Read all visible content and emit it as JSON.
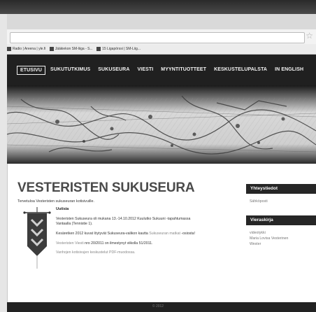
{
  "browser": {
    "bookmarks": [
      {
        "label": "Radio | Areena | yle.fi"
      },
      {
        "label": "Jääkiekon SM-liiga - S..."
      },
      {
        "label": "15 Ligapörssi | SM-Liig..."
      }
    ],
    "star_icon": "star-icon"
  },
  "nav": {
    "items": [
      "ETUSIVU",
      "SUKUTUTKIMUS",
      "SUKUSEURA",
      "VIESTI",
      "MYYNTITUOTTEET",
      "KESKUSTELUPALSTA",
      "IN ENGLISH"
    ],
    "active_index": 0
  },
  "main": {
    "title": "VESTERISTEN SUKUSEURA",
    "welcome": "Tervetuloa Vesteristen sukuseuran kotisivuille.",
    "news_heading": "Uutisia",
    "news": {
      "item1_line1": "Vesteristen Sukuseura oli mukana 13.-14.10.2012 Kuulutko Sukuuni -tapahtumassa",
      "item1_line2": "Vantaalla (Tennistie 1).",
      "item2_text": "Kesäretken 2012 kuvat löytyvät Sukuseura-valikon kautta ",
      "item2_link1": "Sukuseuran matkat",
      "item2_link2": "-osiosta!",
      "item3_link": "Vesteristen Viesti",
      "item3_text": " nro 20/2011 on ilmestynyt viikolla 51/2011.",
      "item4_link": "Vanhojen kotisivujen keskustelut PDF-muodossa."
    }
  },
  "sidebar": {
    "contact_heading": "Yhteystiedot",
    "contact_link": "Sähköposti",
    "guestbook_heading": "Vieraskirja",
    "guestbook_items": [
      "videotykki",
      "Maria Lovisa Vesterinen",
      "Wester"
    ]
  },
  "footer": {
    "text": "© 2012"
  },
  "colors": {
    "navbar": "#202020",
    "sidebar_heading": "#262626",
    "title": "#4a4a4a",
    "link": "#888888"
  }
}
